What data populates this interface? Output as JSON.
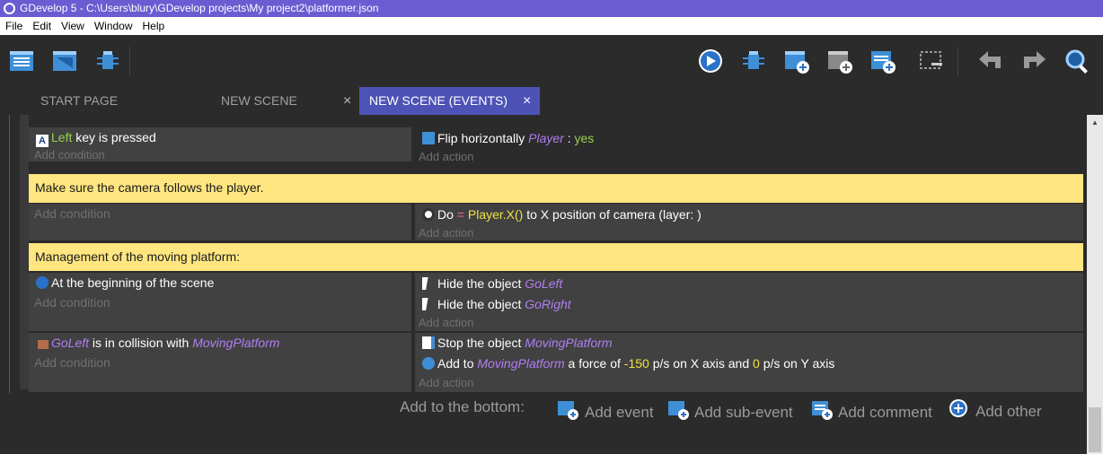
{
  "window": {
    "title": "GDevelop 5 - C:\\Users\\blury\\GDevelop projects\\My project2\\platformer.json"
  },
  "menu": [
    "File",
    "Edit",
    "View",
    "Window",
    "Help"
  ],
  "toolbar": {
    "left_icons": [
      "project-manager-icon",
      "scene-editor-icon",
      "debugger-icon"
    ],
    "right_icons": [
      "preview-play-icon",
      "debug-icon",
      "add-event-icon",
      "add-subevent-icon",
      "add-comment-icon",
      "delete-icon",
      "undo-icon",
      "redo-icon",
      "search-icon"
    ]
  },
  "tabs": [
    {
      "label": "START PAGE",
      "closable": false,
      "active": false
    },
    {
      "label": "NEW SCENE",
      "closable": true,
      "active": false
    },
    {
      "label": "NEW SCENE (EVENTS)",
      "closable": true,
      "active": true
    }
  ],
  "tab_close_glyph": "×",
  "events": {
    "event1": {
      "condition": {
        "key": "Left",
        "rest": " key is pressed"
      },
      "add_condition": "Add condition",
      "action": {
        "text": "Flip horizontally ",
        "object": "Player",
        "sep": " : ",
        "value": "yes"
      },
      "add_action": "Add action"
    },
    "comment1": "Make sure the camera follows the player.",
    "event2": {
      "add_condition": "Add condition",
      "action": {
        "do": "Do ",
        "op": "=",
        "expr": "Player.X()",
        "rest": " to X position of camera  (layer: )"
      },
      "add_action": "Add action"
    },
    "comment2": "Management of the moving platform:",
    "event3": {
      "condition": "At the beginning of the scene",
      "add_condition": "Add condition",
      "action1": {
        "text": "Hide the object ",
        "object": "GoLeft"
      },
      "action2": {
        "text": "Hide the object ",
        "object": "GoRight"
      },
      "add_action": "Add action"
    },
    "event4": {
      "condition": {
        "object": "GoLeft",
        "mid": " is in collision with ",
        "target": "MovingPlatform"
      },
      "add_condition": "Add condition",
      "action1": {
        "text": "Stop the object ",
        "object": "MovingPlatform"
      },
      "action2": {
        "pre": "Add to ",
        "object": "MovingPlatform",
        "mid": " a force of ",
        "x": "-150",
        "mid2": " p/s on X axis and ",
        "y": "0",
        "post": " p/s on Y axis"
      },
      "add_action": "Add action"
    }
  },
  "bottom": {
    "label": "Add to the bottom:",
    "add_event": "Add event",
    "add_subevent": "Add sub-event",
    "add_comment": "Add comment",
    "add_other": "Add other"
  },
  "colors": {
    "titlebar": "#6b5cd1",
    "active_tab": "#4d53b6",
    "comment_bg": "#ffe680",
    "object_name": "#b07ef2",
    "value_green": "#99d24f",
    "expression_yellow": "#f1e13f"
  }
}
